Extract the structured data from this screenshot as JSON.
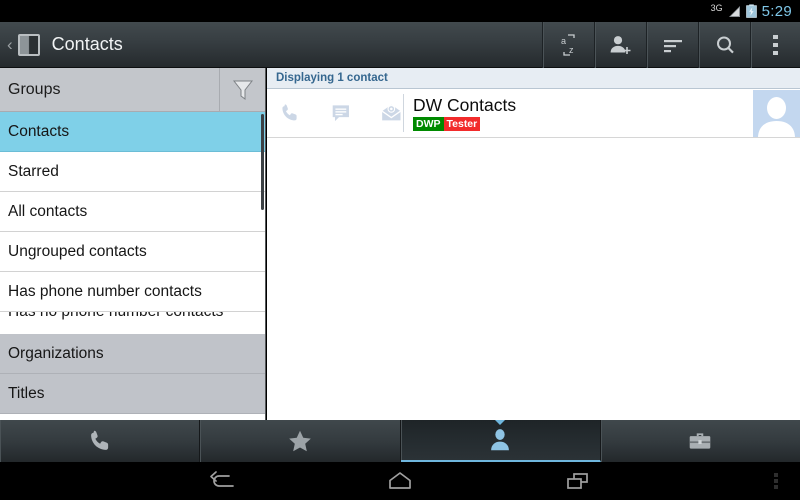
{
  "status_bar": {
    "network_label": "3G",
    "time": "5:29",
    "signal_icon": "signal-bars-icon",
    "battery_icon": "battery-charging-icon",
    "time_color": "#7fc7e8"
  },
  "action_bar": {
    "back_icon": "back-chevron-icon",
    "app_icon": "contacts-app-icon",
    "title": "Contacts",
    "actions": [
      {
        "name": "sort-alphabetical-button",
        "icon": "a-z-sort-icon"
      },
      {
        "name": "add-contact-button",
        "icon": "person-add-icon"
      },
      {
        "name": "display-options-button",
        "icon": "sort-lines-icon"
      },
      {
        "name": "search-button",
        "icon": "search-magnifier-icon"
      },
      {
        "name": "overflow-menu-button",
        "icon": "three-dots-vertical-icon"
      }
    ]
  },
  "sidebar": {
    "header": {
      "label": "Groups",
      "filter_icon": "funnel-filter-icon"
    },
    "items": [
      {
        "label": "Contacts",
        "state": "selected"
      },
      {
        "label": "Starred",
        "state": "normal"
      },
      {
        "label": "All contacts",
        "state": "normal"
      },
      {
        "label": "Ungrouped contacts",
        "state": "normal"
      },
      {
        "label": "Has phone number contacts",
        "state": "normal"
      },
      {
        "label": "Has no phone number contacts",
        "state": "clipped"
      },
      {
        "label": "Organizations",
        "state": "section"
      },
      {
        "label": "Titles",
        "state": "section"
      }
    ],
    "selected_color": "#7fd0e8",
    "section_color": "#c0c3c9"
  },
  "content": {
    "display_header": "Displaying 1 contact",
    "contact": {
      "name": "DW Contacts",
      "badges": [
        {
          "text": "DWP",
          "color": "#008a00"
        },
        {
          "text": "Tester",
          "color": "#f22b2b"
        }
      ],
      "quick_actions": [
        {
          "name": "call-contact-icon",
          "icon": "phone-handset-icon"
        },
        {
          "name": "message-contact-icon",
          "icon": "speech-bubble-icon"
        },
        {
          "name": "email-contact-icon",
          "icon": "envelope-at-icon"
        }
      ],
      "avatar_icon": "person-placeholder-avatar"
    }
  },
  "tab_bar": {
    "tabs": [
      {
        "name": "tab-phone",
        "icon": "phone-handset-icon",
        "active": false
      },
      {
        "name": "tab-favorites",
        "icon": "star-icon",
        "active": false
      },
      {
        "name": "tab-contacts",
        "icon": "person-icon",
        "active": true
      },
      {
        "name": "tab-groups",
        "icon": "briefcase-icon",
        "active": false
      }
    ],
    "active_indicator_color": "#6fb7de"
  },
  "nav_bar": {
    "buttons": [
      {
        "name": "nav-back-button",
        "icon": "back-arrow-icon"
      },
      {
        "name": "nav-home-button",
        "icon": "home-icon"
      },
      {
        "name": "nav-recents-button",
        "icon": "recent-apps-icon"
      }
    ],
    "menu_icon": "three-dots-vertical-icon"
  }
}
